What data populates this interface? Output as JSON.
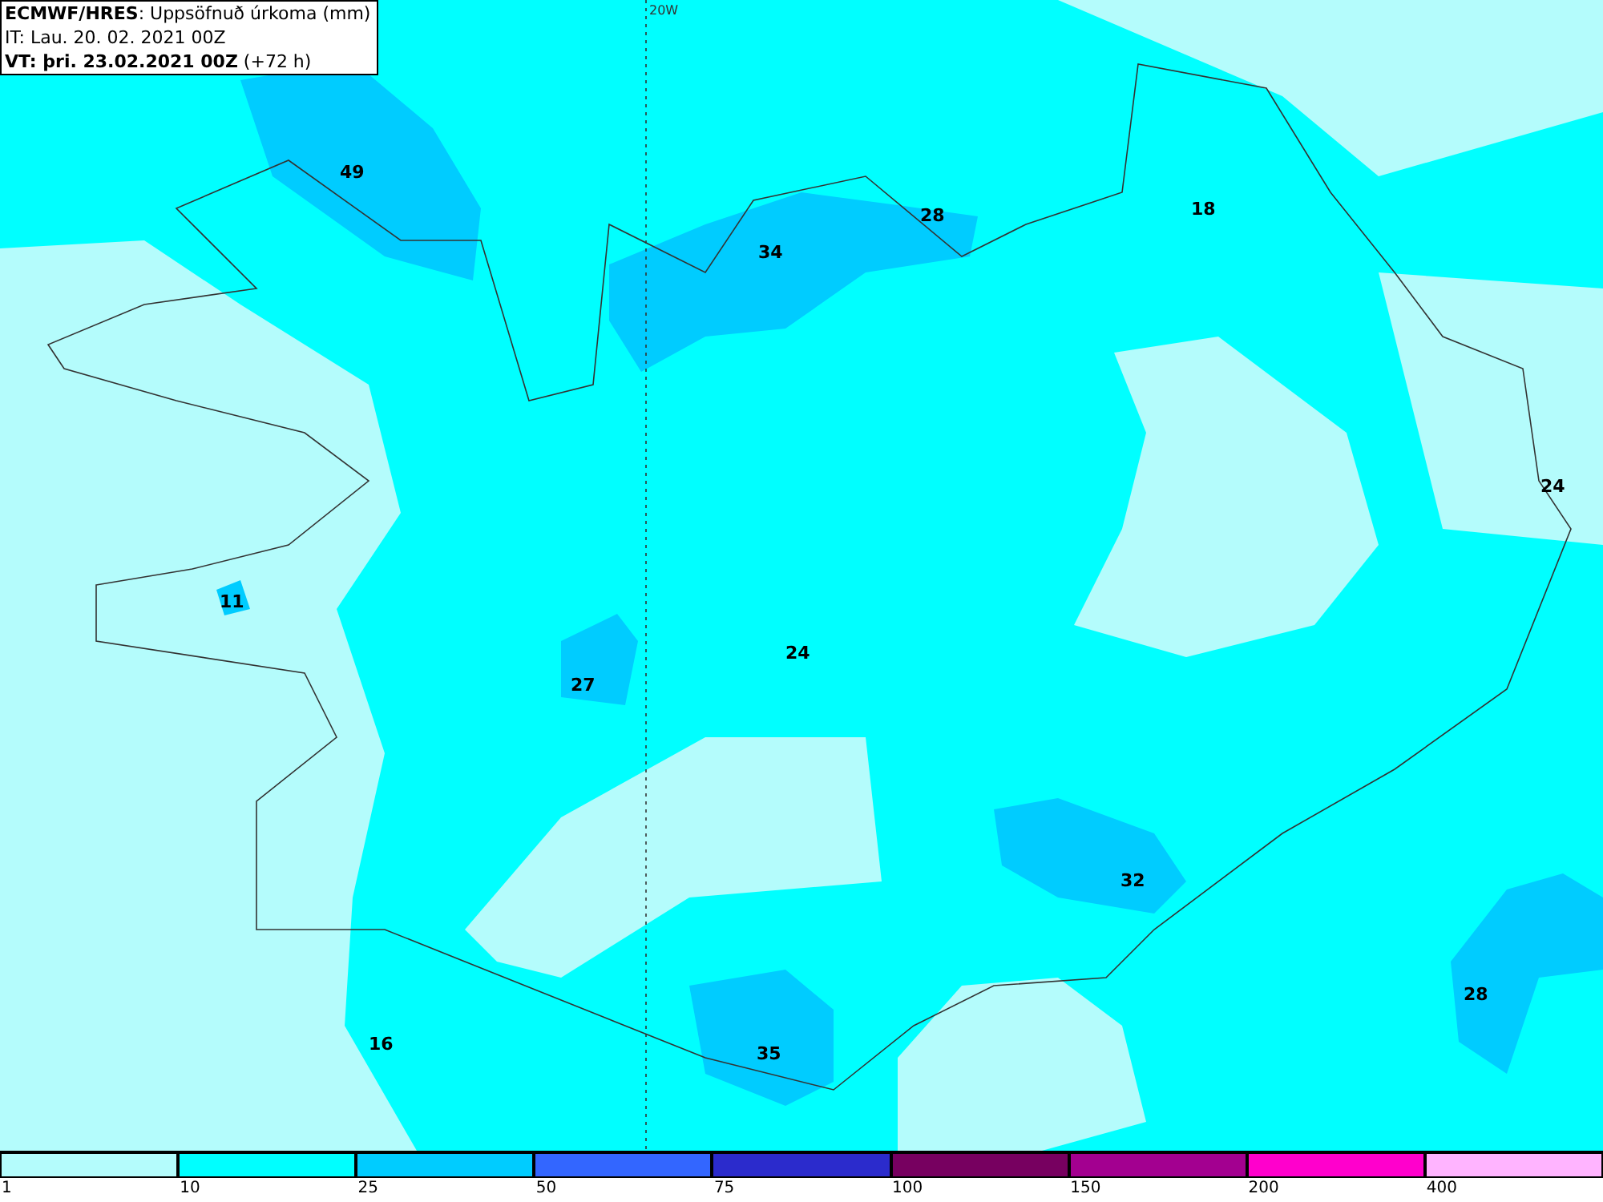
{
  "header": {
    "lines": [
      "**ECMWF/HRES**: Uppsöfnuð úrkoma (mm)",
      "IT: Lau. 20. 02. 2021 00Z",
      "**VT: þri. 23.02.2021 00Z** (+72 h)"
    ]
  },
  "meridian_label": "20W",
  "map_values": [
    {
      "text": "49"
    },
    {
      "text": "34"
    },
    {
      "text": "28"
    },
    {
      "text": "18"
    },
    {
      "text": "24"
    },
    {
      "text": "11"
    },
    {
      "text": "27"
    },
    {
      "text": "24"
    },
    {
      "text": "32"
    },
    {
      "text": "28"
    },
    {
      "text": "16"
    },
    {
      "text": "35"
    }
  ],
  "legend": [
    {
      "label": "1",
      "color": "#b4fcfc"
    },
    {
      "label": "10",
      "color": "#00ffff"
    },
    {
      "label": "25",
      "color": "#00ccff"
    },
    {
      "label": "50",
      "color": "#3366ff"
    },
    {
      "label": "75",
      "color": "#2b2bcc"
    },
    {
      "label": "100",
      "color": "#770060"
    },
    {
      "label": "150",
      "color": "#a30090"
    },
    {
      "label": "200",
      "color": "#ff00cc"
    },
    {
      "label": "400",
      "color": "#ffb4ff"
    }
  ]
}
